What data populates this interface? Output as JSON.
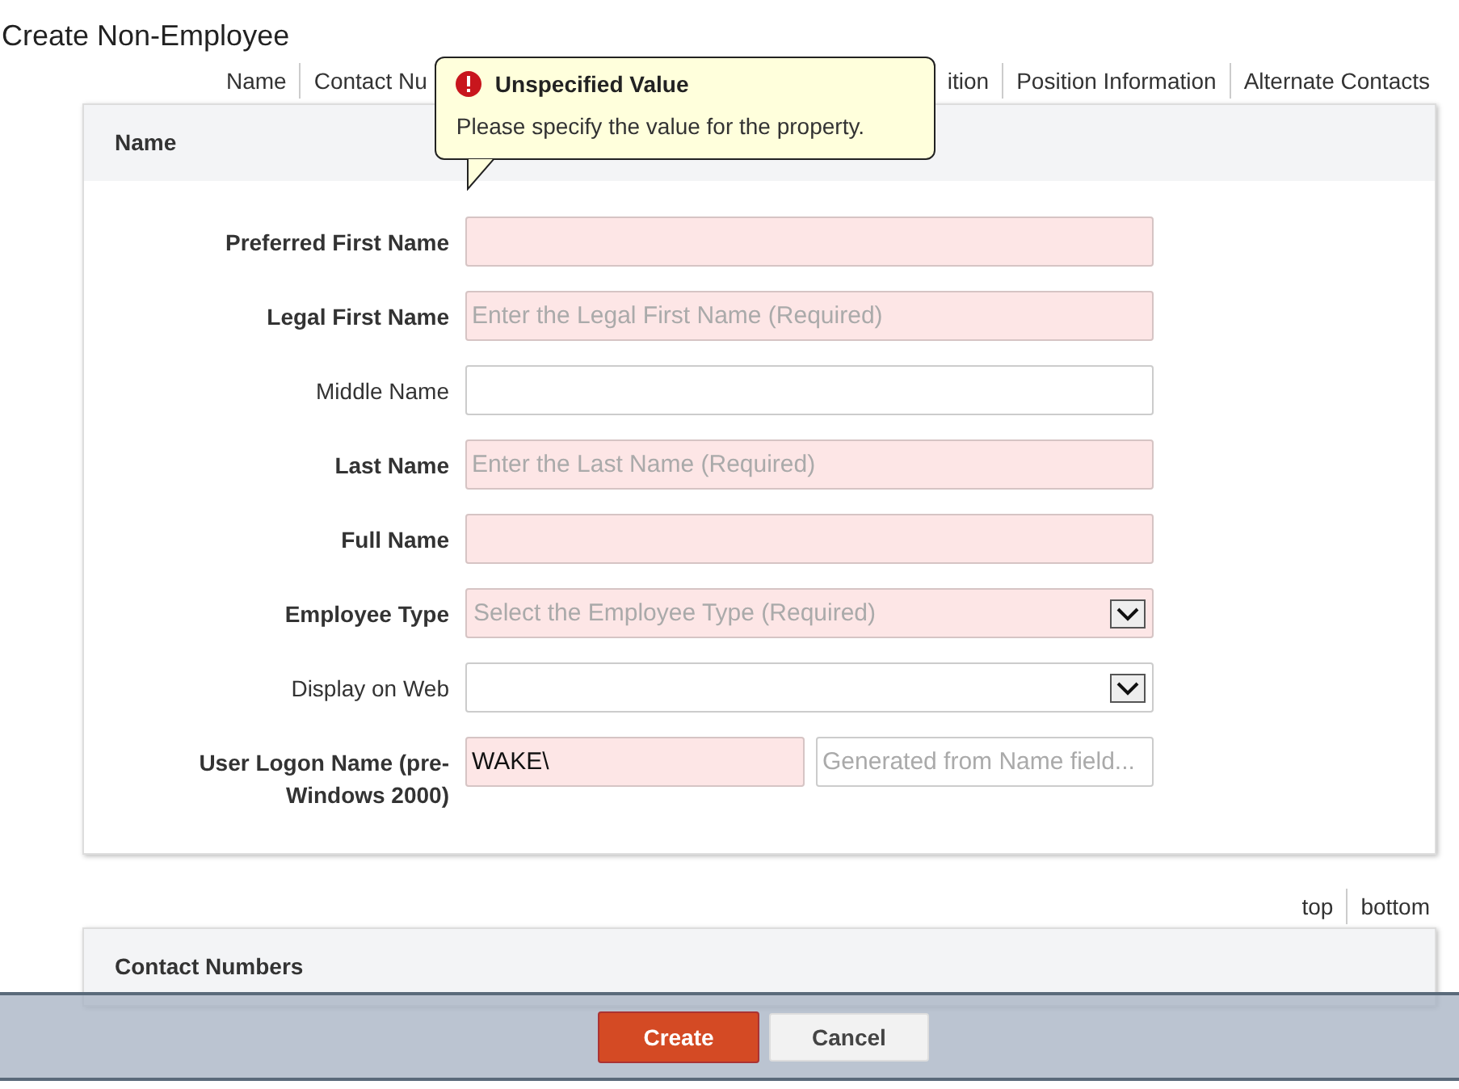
{
  "page_title": "Create Non-Employee",
  "nav": {
    "links_before": [
      "Name",
      "Contact Nu"
    ],
    "links_after": [
      "ition",
      "Position Information",
      "Alternate Contacts"
    ]
  },
  "tooltip": {
    "title": "Unspecified Value",
    "message": "Please specify the value for the property."
  },
  "sections": [
    {
      "title": "Name",
      "fields": [
        {
          "kind": "text",
          "label": "Preferred First Name",
          "required": true
        },
        {
          "kind": "text",
          "label": "Legal First Name",
          "required": true,
          "placeholder": "Enter the Legal First Name (Required)"
        },
        {
          "kind": "text",
          "label": "Middle Name",
          "required": false
        },
        {
          "kind": "text",
          "label": "Last Name",
          "required": true,
          "placeholder": "Enter the Last Name (Required)"
        },
        {
          "kind": "text",
          "label": "Full Name",
          "required": true
        },
        {
          "kind": "select",
          "label": "Employee Type",
          "required": true,
          "placeholder": "Select the Employee Type (Required)"
        },
        {
          "kind": "select",
          "label": "Display on Web",
          "required": false
        },
        {
          "kind": "split",
          "label": "User Logon Name (pre-Windows 2000)",
          "required": true,
          "value": "WAKE\\",
          "placeholder": "Generated from Name field..."
        }
      ]
    },
    {
      "title": "Contact Numbers"
    }
  ],
  "jump_links": [
    "top",
    "bottom"
  ],
  "buttons": [
    {
      "kind": "primary",
      "label": "Create"
    },
    {
      "kind": "secondary",
      "label": "Cancel"
    }
  ]
}
